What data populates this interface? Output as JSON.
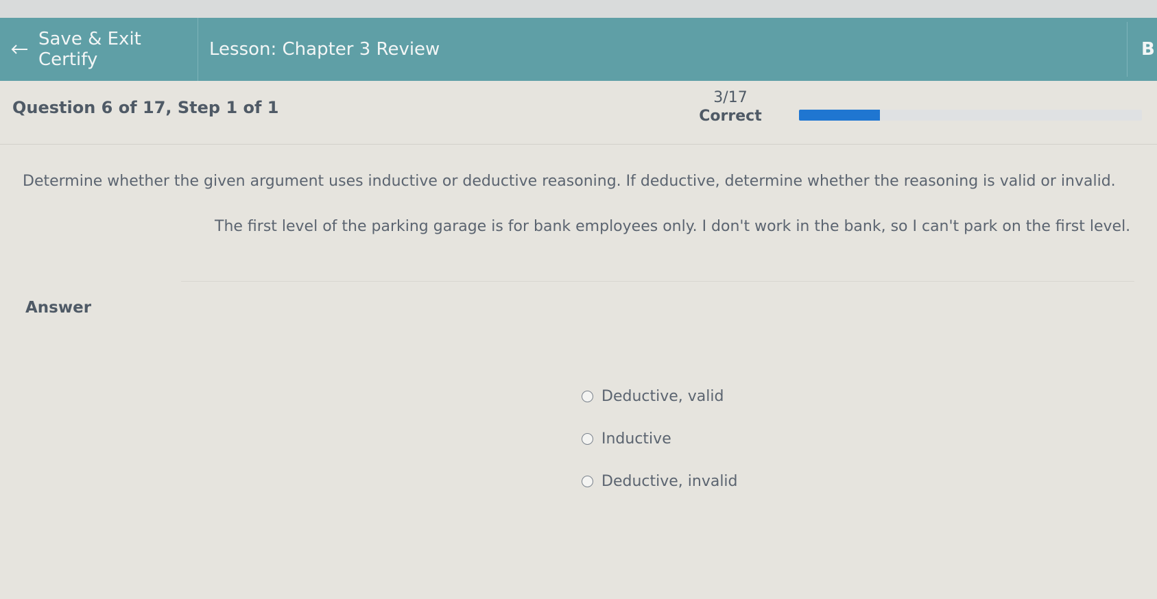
{
  "nav": {
    "back_label": "Save & Exit Certify",
    "lesson_title": "Lesson: Chapter 3 Review",
    "right_truncated": "B"
  },
  "question": {
    "label": "Question 6 of 17, Step 1 of 1",
    "prompt": "Determine whether the given argument uses inductive or deductive reasoning. If deductive, determine whether the reasoning is valid or invalid.",
    "argument": "The first level of the parking garage is for bank employees only. I don't work in the bank, so I can't park on the first level."
  },
  "score": {
    "value": "3/17",
    "caption": "Correct",
    "progress_fraction": 0.2353
  },
  "answer": {
    "label": "Answer",
    "options": [
      {
        "label": "Deductive, valid",
        "selected": false
      },
      {
        "label": "Inductive",
        "selected": false
      },
      {
        "label": "Deductive, invalid",
        "selected": false
      }
    ]
  },
  "colors": {
    "navbar": "#5f9fa6",
    "progress": "#1f76d1",
    "page_background": "#e6e4de"
  }
}
